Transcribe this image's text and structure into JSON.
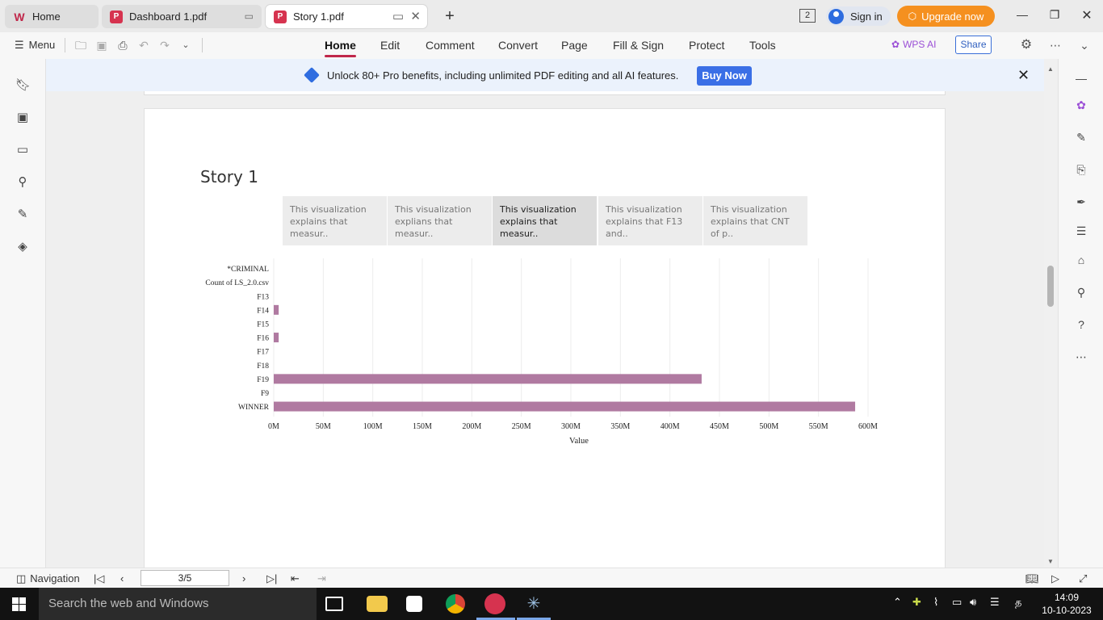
{
  "tabs": [
    {
      "label": "Home",
      "active": false
    },
    {
      "label": "Dashboard 1.pdf",
      "active": false
    },
    {
      "label": "Story 1.pdf",
      "active": true
    }
  ],
  "header": {
    "page_count_badge": "2",
    "sign_in": "Sign in",
    "upgrade": "Upgrade now"
  },
  "toolbar": {
    "menu": "Menu",
    "tabs": [
      "Home",
      "Edit",
      "Comment",
      "Convert",
      "Page",
      "Fill & Sign",
      "Protect",
      "Tools"
    ],
    "active_tab": "Home",
    "wps_ai": "WPS AI",
    "share": "Share"
  },
  "banner": {
    "text": "Unlock 80+ Pro benefits, including unlimited PDF editing and all AI features.",
    "button": "Buy Now"
  },
  "document": {
    "title": "Story 1",
    "story_points": [
      {
        "line1": "This visualization",
        "line2": "explains that measur..",
        "active": false
      },
      {
        "line1": "This visualization",
        "line2": "explians that measur..",
        "active": false
      },
      {
        "line1": "This visualization",
        "line2": "explains that measur..",
        "active": true
      },
      {
        "line1": "This visualization",
        "line2": "explains that F13 and..",
        "active": false
      },
      {
        "line1": "This visualization",
        "line2": "explains that CNT of p..",
        "active": false
      }
    ]
  },
  "chart_data": {
    "type": "bar",
    "orientation": "horizontal",
    "categories": [
      "*CRIMINAL",
      "Count of LS_2.0.csv",
      "F13",
      "F14",
      "F15",
      "F16",
      "F17",
      "F18",
      "F19",
      "F9",
      "WINNER"
    ],
    "values": [
      0,
      0,
      0,
      5,
      0,
      5,
      0,
      0,
      432,
      0,
      587
    ],
    "value_unit": "M",
    "xlabel": "Value",
    "xlim": [
      0,
      600
    ],
    "xticks": [
      "0M",
      "50M",
      "100M",
      "150M",
      "200M",
      "250M",
      "300M",
      "350M",
      "400M",
      "450M",
      "500M",
      "550M",
      "600M"
    ],
    "grid": true,
    "bar_color": "#b07aa1"
  },
  "statusbar": {
    "navigation": "Navigation",
    "page_indicator": "3/5"
  },
  "taskbar": {
    "search_placeholder": "Search the web and Windows",
    "time": "14:09",
    "date": "10-10-2023"
  }
}
